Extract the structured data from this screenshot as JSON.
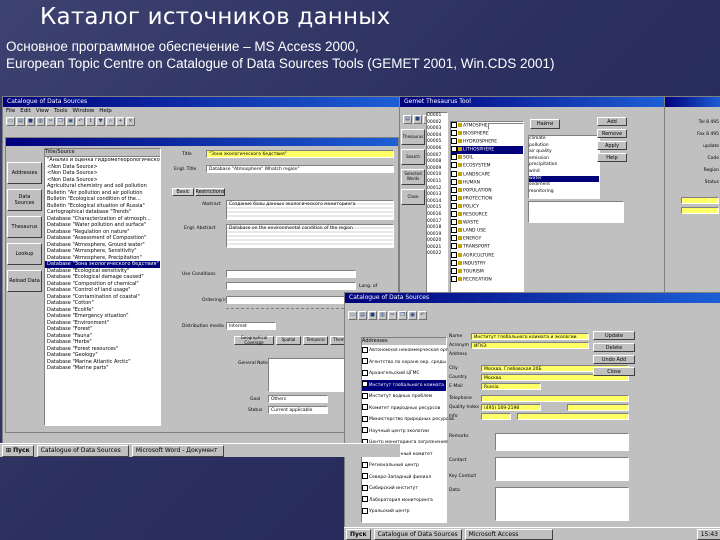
{
  "slide": {
    "title": "Каталог источников данных",
    "line1": "Основное программное обеспечение – MS Access 2000,",
    "line2": "European Topic Centre on Catalogue of Data Sources Tools (GEMET 2001, Win.CDS 2001)"
  },
  "main_window": {
    "title": "Catalogue of Data Sources",
    "menu": [
      "File",
      "Edit",
      "View",
      "Tools",
      "Window",
      "Help"
    ],
    "side_buttons": [
      "Addresses",
      "Data Sources",
      "Thesaurus",
      "Lookup",
      "Reload Data"
    ],
    "list_header": "Title/Source",
    "rows": [
      "\"Анализ и оценка гидрометеорологической...",
      "<Non Data Source>",
      "<Non Data Source>",
      "<Non Data Source>",
      "Agricultural  chemistry and soil pollution",
      "Bulletin \"Air pollution  and air pollution",
      "Bulletin \"Ecological condition of the...",
      "Bulletin \"Ecological situation of Russia\"",
      "Cartographical database \"Trends\"",
      "Database \"Characterization of atmosph...",
      "Database \"Water pollution and surface\"",
      "Database \"Regulation on nature\"",
      "Database \"Assessment of Composition\"",
      "Database \"Atmosphere, Ground water\"",
      "Database \"Atmosphere, Sensitivity\"",
      "Database \"Atmosphere, Precipitation\"",
      "Database \"Зона экологического бедствия\"",
      "Database \"Ecological sensitivity\"",
      "Database \"Ecological damage caused\"",
      "Database \"Composition of chemical\"",
      "Database \"Control of land usage\"",
      "Database \"Contamination of coastal\"",
      "Database \"Cotton\"",
      "Database \"Ecolife\"",
      "Database \"Emergency situation\"",
      "Database \"Environment\"",
      "Database \"Forest\"",
      "Database \"Fauna\"",
      "Database \"Herbs\"",
      "Database \"Forest resources\"",
      "Database \"Geology\"",
      "Database \"Marine Atlantic Arctic\"",
      "Database \"Marine parts\""
    ],
    "selected_row": 16,
    "tabs": [
      "Basic",
      "Restrictions"
    ],
    "labels": {
      "title": "Title",
      "engl_title": "Engl. Title",
      "abstract": "Abstract",
      "engl_abstract": "Engl. Abstract",
      "use_conditions": "Use Conditions",
      "ordering": "Ordering info",
      "distribution": "Distribution media",
      "geo_coverage": "Geographical Coverage",
      "spatial": "Spatial",
      "temporal": "Temporal",
      "thematic": "Thematic",
      "general": "General Notes",
      "lang": "Lang. of",
      "goal": "Goal",
      "status": "Status"
    },
    "values": {
      "title": "\"Зона экологического бедствия\"",
      "engl_title": "Database \"Atmosphere\" Whatch region\"",
      "abstract": "Создание базы данных экологического мониторинга",
      "engl_abstract": "Database on the environmental condition of the region",
      "distribution": "Internet",
      "goal": "Others",
      "status": "Current applicable"
    }
  },
  "thesaurus_window": {
    "title": "Gemet Thesaurus Tool",
    "side_buttons": [
      "Thesaurus",
      "Search",
      "Selected Words",
      "Close"
    ],
    "codes": [
      "00001",
      "00002",
      "00003",
      "00004",
      "00005",
      "00006",
      "00007",
      "00008",
      "00009",
      "00010",
      "00011",
      "00012",
      "00013",
      "00014",
      "00015",
      "00016",
      "00017",
      "00018",
      "00019",
      "00020",
      "00021",
      "00022"
    ],
    "tree": [
      "ATMOSPHERE",
      "BIOSPHERE",
      "HYDROSPHERE",
      "LITHOSPHERE",
      "SOIL",
      "ECOSYSTEM",
      "LANDSCAPE",
      "HUMAN",
      "POPULATION",
      "PROTECTION",
      "POLICY",
      "RESOURCE",
      "WASTE",
      "LAND USE",
      "ENERGY",
      "TRANSPORT",
      "AGRICULTURE",
      "INDUSTRY",
      "TOURISM",
      "RECREATION"
    ],
    "selected_tree": 3,
    "right_list": [
      "climate",
      "pollution",
      "air quality",
      "emission",
      "precipitation",
      "wind",
      "water",
      "sediment",
      "monitoring"
    ],
    "selected_right": 6,
    "buttons": [
      "Add",
      "Remove",
      "Apply",
      "Help"
    ],
    "search_btn": "Найти"
  },
  "right_panel": {
    "rows": [
      "Tel 8 495",
      "Fax 8 495",
      "update",
      "Code",
      "Region",
      "Status"
    ]
  },
  "sources_window": {
    "title": "Catalogue of Data Sources",
    "form_labels": [
      "Name",
      "Acronym",
      "Address",
      "City",
      "Country",
      "E-Mail",
      "Telephone",
      "Quality Index",
      "Info",
      "Remarks",
      "Contact",
      "Key Contact",
      "Data"
    ],
    "name_value": "Институт глобального климата и экологии",
    "acronym_value": "ИГКЭ",
    "address_value": "Москва, Глебовская 20Б",
    "city_value": "Москва",
    "phone_value": "(495) 169-2198",
    "country_value": "Russia",
    "buttons": [
      "Update",
      "Delete",
      "Undo Add",
      "Close"
    ],
    "list_header": "Addresses",
    "list_rows": [
      "Автономная некоммерческая орг.",
      "Агентство по охране окр. среды",
      "Архангельский ЦГМС",
      "Институт глобального климата",
      "Институт водных проблем",
      "Комитет природных ресурсов",
      "Министерство природных ресурсов",
      "Научный центр экологии",
      "Центр мониторинга загрязнения",
      "Государственный комитет",
      "Региональный центр",
      "Северо-Западный филиал",
      "Сибирский институт",
      "Лаборатория мониторинга",
      "Уральский центр"
    ],
    "selected_row": 3
  },
  "taskbar": {
    "start": "Пуск",
    "items": [
      "Catalogue of Data Sources",
      "Microsoft Word - Документ"
    ],
    "items2": [
      "Catalogue of Data Sources",
      "Microsoft Access"
    ],
    "clock": "15:43"
  },
  "colors": {
    "background": "#2b3060",
    "titlebar": "#00007a",
    "highlight": "#ffff66",
    "selection": "#00007a"
  }
}
